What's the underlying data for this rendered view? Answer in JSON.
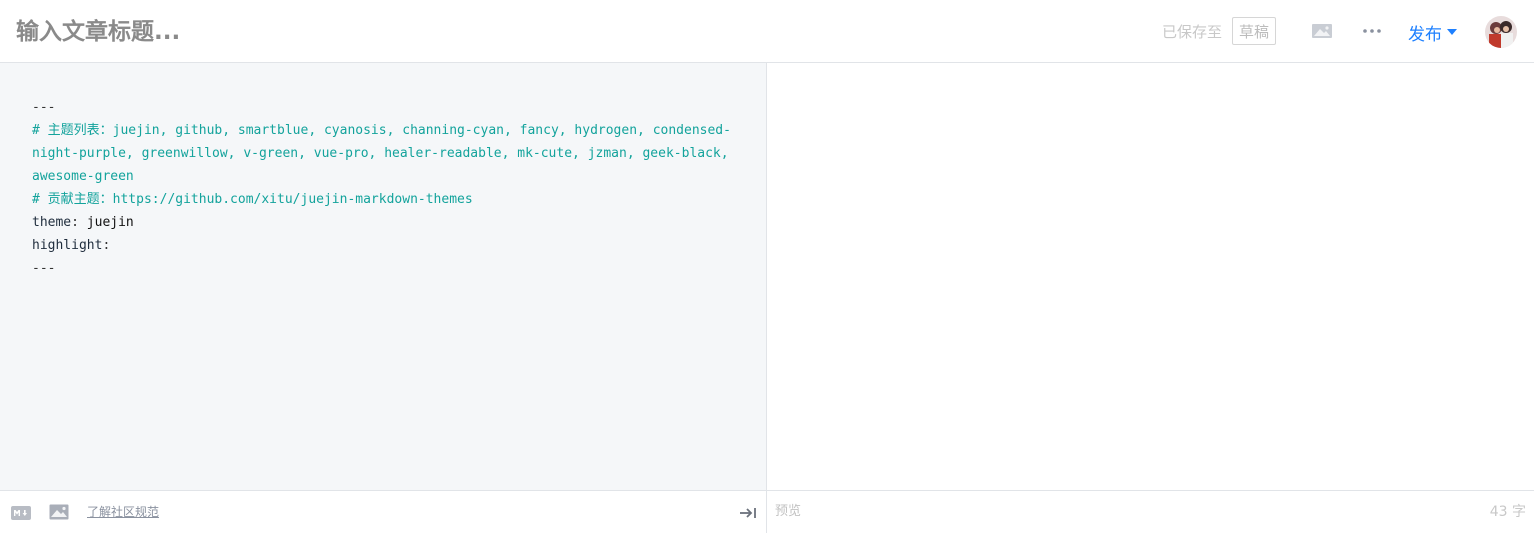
{
  "header": {
    "title_placeholder": "输入文章标题...",
    "save_status": "已保存至",
    "draft_label": "草稿",
    "publish_label": "发布",
    "image_icon": "image-icon",
    "more_icon": "more-icon"
  },
  "editor": {
    "lines": [
      {
        "parts": [
          {
            "text": "---",
            "kind": "plain"
          }
        ]
      },
      {
        "parts": [
          {
            "text": "# 主题列表：juejin, github, smartblue, cyanosis, channing-cyan, fancy, hydrogen, condensed-night-purple, greenwillow, v-green, vue-pro, healer-readable, mk-cute, jzman, geek-black, awesome-green",
            "kind": "comment"
          }
        ]
      },
      {
        "parts": [
          {
            "text": "# 贡献主题：https://github.com/xitu/juejin-markdown-themes",
            "kind": "comment"
          }
        ]
      },
      {
        "parts": [
          {
            "text": "theme",
            "kind": "key"
          },
          {
            "text": ": ",
            "kind": "plain"
          },
          {
            "text": "juejin",
            "kind": "val"
          }
        ]
      },
      {
        "parts": [
          {
            "text": "highlight",
            "kind": "key"
          },
          {
            "text": ":",
            "kind": "plain"
          }
        ]
      },
      {
        "parts": [
          {
            "text": "---",
            "kind": "plain"
          }
        ]
      }
    ]
  },
  "footer": {
    "rules_link": "了解社区规范",
    "preview_label": "预览",
    "word_count": "43 字",
    "md_icon": "markdown-icon",
    "picture_icon": "picture-icon",
    "collapse_icon": "collapse-arrow-icon"
  },
  "colors": {
    "accent": "#1e80ff",
    "comment": "#13a39c",
    "editor_bg": "#f5f7f9"
  }
}
